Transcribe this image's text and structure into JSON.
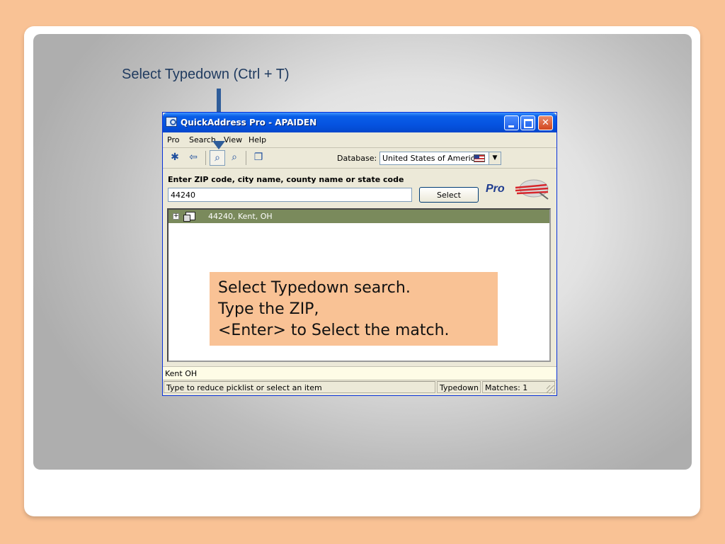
{
  "slide": {
    "heading": "Select Typedown (Ctrl + T)",
    "note_lines": [
      "Select Typedown search.",
      "Type the ZIP,",
      "<Enter> to Select the match."
    ]
  },
  "window": {
    "title": "QuickAddress Pro - APAIDEN",
    "menu": [
      "Pro",
      "Search",
      "View",
      "Help"
    ],
    "toolbar": {
      "database_label": "Database:",
      "database_value": "United States of America",
      "icons": [
        "new-search-icon",
        "back-arrow-icon",
        "typedown-icon",
        "refine-search-icon",
        "copy-icon"
      ]
    },
    "search": {
      "prompt": "Enter ZIP code, city name, county name or state code",
      "value": "44240",
      "button_label": "Select"
    },
    "logo_text": "Pro",
    "picklist": [
      {
        "label": "44240, Kent, OH"
      }
    ],
    "status": {
      "address_preview": "Kent OH",
      "hint": "Type to reduce picklist or select an item",
      "mode": "Typedown",
      "matches": "Matches: 1"
    }
  },
  "colors": {
    "background": "#f9c295",
    "heading": "#1f3a5f",
    "arrow": "#2f5d9a",
    "selection": "#7a8a5c"
  }
}
